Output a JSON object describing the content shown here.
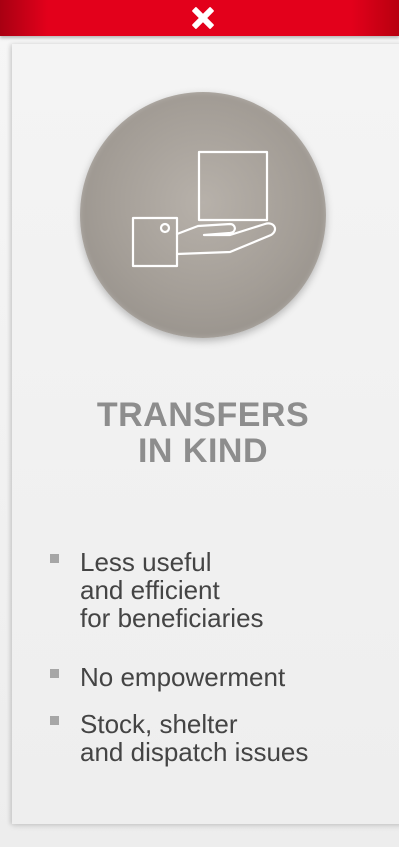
{
  "icons": {
    "close": "close-icon",
    "main": "box-in-hand-icon"
  },
  "colors": {
    "top_bar": "#e3001b",
    "icon_circle": "#a39d96",
    "title": "#8d8d8d",
    "bullet_text": "#444444",
    "bullet_marker": "#a6a6a6"
  },
  "title": {
    "line1": "TRANSFERS",
    "line2": "IN KIND"
  },
  "bullets": [
    {
      "lines": [
        "Less useful",
        "and efficient",
        "for beneficiaries"
      ]
    },
    {
      "lines": [
        "No empowerment"
      ]
    },
    {
      "lines": [
        "Stock, shelter",
        "and dispatch issues"
      ]
    }
  ]
}
